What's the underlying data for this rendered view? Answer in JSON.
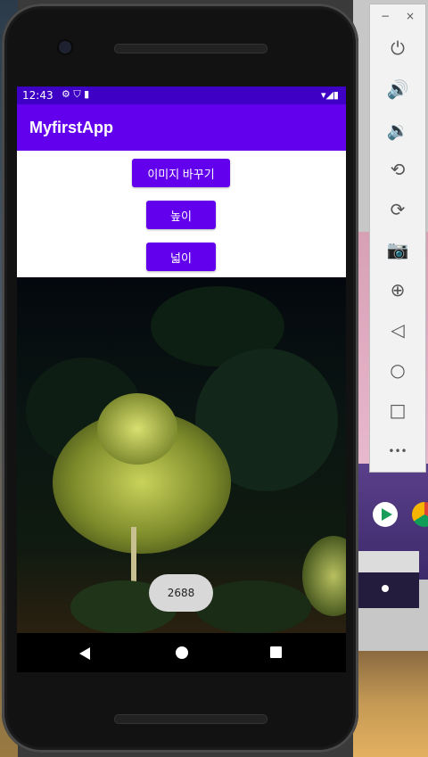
{
  "status_bar": {
    "time": "12:43",
    "left_icons": "⚙ ⛉ ▮",
    "right_icons": "▾◢▮"
  },
  "app_bar": {
    "title": "MyfirstApp"
  },
  "buttons": {
    "change_image": "이미지 바꾸기",
    "height": "높이",
    "width": "넓이"
  },
  "toast": {
    "text": "2688"
  },
  "toolbar": {
    "minimize": "−",
    "close": "×",
    "items": [
      {
        "name": "power-icon",
        "glyph": "⏻"
      },
      {
        "name": "volume-up-icon",
        "glyph": "🔊"
      },
      {
        "name": "volume-down-icon",
        "glyph": "🔉"
      },
      {
        "name": "rotate-left-icon",
        "glyph": "⟲"
      },
      {
        "name": "rotate-right-icon",
        "glyph": "⟳"
      },
      {
        "name": "camera-icon",
        "glyph": "📷"
      },
      {
        "name": "zoom-icon",
        "glyph": "⊕"
      },
      {
        "name": "back-icon",
        "glyph": "◁"
      },
      {
        "name": "home-icon",
        "glyph": "○"
      },
      {
        "name": "overview-icon",
        "glyph": "□"
      },
      {
        "name": "more-icon",
        "glyph": "•••"
      }
    ]
  },
  "colors": {
    "primary": "#6200ee",
    "primary_dark": "#3d00c4"
  }
}
